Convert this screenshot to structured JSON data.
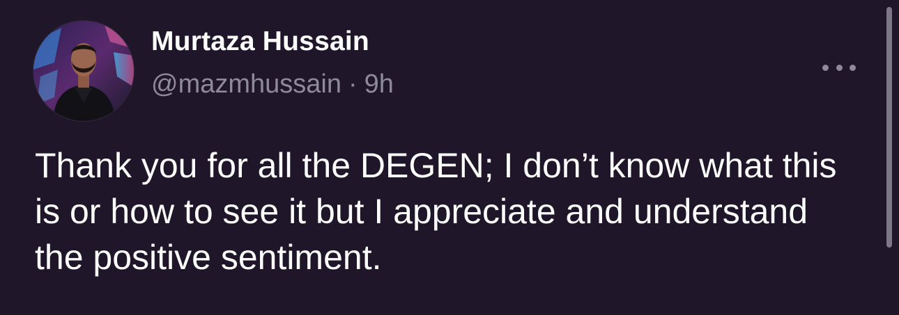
{
  "post": {
    "author_name": "Murtaza Hussain",
    "handle": "@mazmhussain",
    "separator": "·",
    "time": "9h",
    "text": "Thank you for all the DEGEN; I don’t know what this is or how to see it but I appreciate and understand the positive sentiment.",
    "avatar_icon": "profile-photo",
    "more_icon": "more-horizontal-icon"
  },
  "colors": {
    "background": "#201629",
    "primary_text": "#ffffff",
    "secondary_text": "#8e8a99"
  }
}
